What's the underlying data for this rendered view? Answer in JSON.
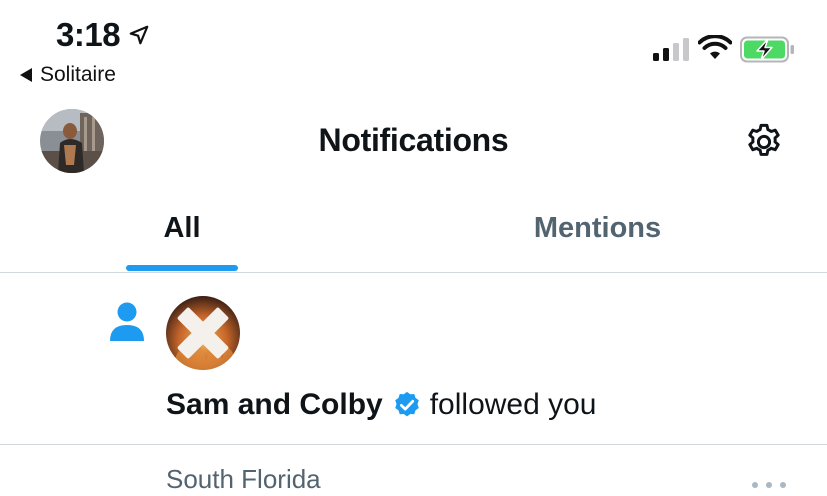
{
  "status_bar": {
    "time": "3:18",
    "back_app": "Solitaire",
    "location_icon": "location-arrow-icon",
    "signal_icon": "cellular-signal-icon",
    "wifi_icon": "wifi-icon",
    "battery_icon": "battery-charging-icon",
    "battery_color": "#4cd964"
  },
  "header": {
    "title": "Notifications",
    "avatar_icon": "profile-avatar",
    "settings_icon": "gear-icon"
  },
  "tabs": [
    {
      "label": "All",
      "active": true
    },
    {
      "label": "Mentions",
      "active": false
    }
  ],
  "notifications": [
    {
      "type_icon": "person-icon",
      "name": "Sam and Colby",
      "verified": true,
      "action": "followed you"
    }
  ],
  "next_item": {
    "location": "South Florida",
    "more_icon": "more-options-icon"
  },
  "colors": {
    "accent": "#1d9bf0",
    "secondary_text": "#536471",
    "divider": "#cfd9de"
  }
}
